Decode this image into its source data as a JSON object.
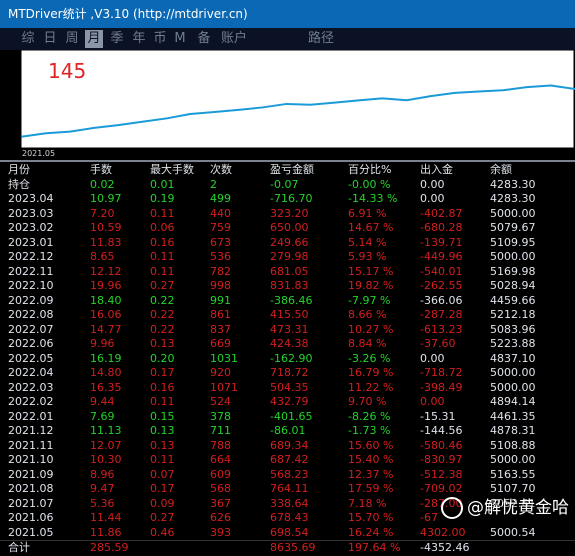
{
  "window": {
    "title": "MTDriver统计 ,V3.10 (http://mtdriver.cn)"
  },
  "tabs": [
    {
      "label": "综",
      "active": false
    },
    {
      "label": "日",
      "active": false
    },
    {
      "label": "周",
      "active": false
    },
    {
      "label": "月",
      "active": true
    },
    {
      "label": "季",
      "active": false
    },
    {
      "label": "年",
      "active": false
    },
    {
      "label": "币",
      "active": false
    },
    {
      "label": "M",
      "active": false
    },
    {
      "label": "备",
      "active": false
    },
    {
      "label": "账户",
      "active": false
    },
    {
      "label": "路径",
      "active": false
    }
  ],
  "chart": {
    "counter": "145",
    "counter_color": "#e02424",
    "line_color": "#1a9bd8",
    "x_label": "2021.05"
  },
  "chart_data": {
    "type": "line",
    "title": "",
    "xlabel": "",
    "ylabel": "",
    "x": [
      "2021.05",
      "2021.06",
      "2021.07",
      "2021.08",
      "2021.09",
      "2021.10",
      "2021.11",
      "2021.12",
      "2022.01",
      "2022.02",
      "2022.03",
      "2022.04",
      "2022.05",
      "2022.06",
      "2022.07",
      "2022.08",
      "2022.09",
      "2022.10",
      "2022.11",
      "2022.12",
      "2023.01",
      "2023.02",
      "2023.03",
      "2023.04"
    ],
    "series": [
      {
        "values": [
          698.54,
          1376.97,
          1715.61,
          2479.72,
          3047.95,
          3735.37,
          4424.71,
          5342.65,
          5741.0,
          6173.79,
          6678.14,
          7396.86,
          7234.96,
          7659.34,
          8132.65,
          8548.15,
          8161.69,
          8993.52,
          9674.57,
          9954.55,
          10204.21,
          10854.21,
          11177.41,
          10460.71
        ]
      }
    ],
    "ylim": [
      0,
      12000
    ]
  },
  "table": {
    "headers": [
      "月份",
      "手数",
      "最大手数",
      "次数",
      "盈亏金额",
      "百分比%",
      "出入金",
      "余额"
    ],
    "rows": [
      {
        "month": "持仓",
        "lots": "0.02",
        "max_lots": "0.01",
        "count": "2",
        "pnl": "-0.07",
        "pct": "-0.00 %",
        "deposit": "0.00",
        "balance": "4283.30",
        "color": "green"
      },
      {
        "month": "2023.04",
        "lots": "10.97",
        "max_lots": "0.19",
        "count": "499",
        "pnl": "-716.70",
        "pct": "-14.33 %",
        "deposit": "0.00",
        "balance": "4283.30",
        "color": "green"
      },
      {
        "month": "2023.03",
        "lots": "7.20",
        "max_lots": "0.11",
        "count": "440",
        "pnl": "323.20",
        "pct": "6.91 %",
        "deposit": "-402.87",
        "balance": "5000.00",
        "color": "red"
      },
      {
        "month": "2023.02",
        "lots": "10.59",
        "max_lots": "0.06",
        "count": "759",
        "pnl": "650.00",
        "pct": "14.67 %",
        "deposit": "-680.28",
        "balance": "5079.67",
        "color": "red"
      },
      {
        "month": "2023.01",
        "lots": "11.83",
        "max_lots": "0.16",
        "count": "673",
        "pnl": "249.66",
        "pct": "5.14 %",
        "deposit": "-139.71",
        "balance": "5109.95",
        "color": "red"
      },
      {
        "month": "2022.12",
        "lots": "8.65",
        "max_lots": "0.11",
        "count": "536",
        "pnl": "279.98",
        "pct": "5.93 %",
        "deposit": "-449.96",
        "balance": "5000.00",
        "color": "red"
      },
      {
        "month": "2022.11",
        "lots": "12.12",
        "max_lots": "0.11",
        "count": "782",
        "pnl": "681.05",
        "pct": "15.17 %",
        "deposit": "-540.01",
        "balance": "5169.98",
        "color": "red"
      },
      {
        "month": "2022.10",
        "lots": "19.96",
        "max_lots": "0.27",
        "count": "998",
        "pnl": "831.83",
        "pct": "19.82 %",
        "deposit": "-262.55",
        "balance": "5028.94",
        "color": "red"
      },
      {
        "month": "2022.09",
        "lots": "18.40",
        "max_lots": "0.22",
        "count": "991",
        "pnl": "-386.46",
        "pct": "-7.97 %",
        "deposit": "-366.06",
        "balance": "4459.66",
        "color": "green"
      },
      {
        "month": "2022.08",
        "lots": "16.06",
        "max_lots": "0.22",
        "count": "861",
        "pnl": "415.50",
        "pct": "8.66 %",
        "deposit": "-287.28",
        "balance": "5212.18",
        "color": "red"
      },
      {
        "month": "2022.07",
        "lots": "14.77",
        "max_lots": "0.22",
        "count": "837",
        "pnl": "473.31",
        "pct": "10.27 %",
        "deposit": "-613.23",
        "balance": "5083.96",
        "color": "red"
      },
      {
        "month": "2022.06",
        "lots": "9.96",
        "max_lots": "0.13",
        "count": "669",
        "pnl": "424.38",
        "pct": "8.84 %",
        "deposit": "-37.60",
        "balance": "5223.88",
        "color": "red"
      },
      {
        "month": "2022.05",
        "lots": "16.19",
        "max_lots": "0.20",
        "count": "1031",
        "pnl": "-162.90",
        "pct": "-3.26 %",
        "deposit": "0.00",
        "balance": "4837.10",
        "color": "green"
      },
      {
        "month": "2022.04",
        "lots": "14.80",
        "max_lots": "0.17",
        "count": "920",
        "pnl": "718.72",
        "pct": "16.79 %",
        "deposit": "-718.72",
        "balance": "5000.00",
        "color": "red"
      },
      {
        "month": "2022.03",
        "lots": "16.35",
        "max_lots": "0.16",
        "count": "1071",
        "pnl": "504.35",
        "pct": "11.22 %",
        "deposit": "-398.49",
        "balance": "5000.00",
        "color": "red"
      },
      {
        "month": "2022.02",
        "lots": "9.44",
        "max_lots": "0.11",
        "count": "524",
        "pnl": "432.79",
        "pct": "9.70 %",
        "deposit": "0.00",
        "balance": "4894.14",
        "color": "red"
      },
      {
        "month": "2022.01",
        "lots": "7.69",
        "max_lots": "0.15",
        "count": "378",
        "pnl": "-401.65",
        "pct": "-8.26 %",
        "deposit": "-15.31",
        "balance": "4461.35",
        "color": "green"
      },
      {
        "month": "2021.12",
        "lots": "11.13",
        "max_lots": "0.13",
        "count": "711",
        "pnl": "-86.01",
        "pct": "-1.73 %",
        "deposit": "-144.56",
        "balance": "4878.31",
        "color": "green"
      },
      {
        "month": "2021.11",
        "lots": "12.07",
        "max_lots": "0.13",
        "count": "788",
        "pnl": "689.34",
        "pct": "15.60 %",
        "deposit": "-580.46",
        "balance": "5108.88",
        "color": "red"
      },
      {
        "month": "2021.10",
        "lots": "10.30",
        "max_lots": "0.11",
        "count": "664",
        "pnl": "687.42",
        "pct": "15.40 %",
        "deposit": "-830.97",
        "balance": "5000.00",
        "color": "red"
      },
      {
        "month": "2021.09",
        "lots": "8.96",
        "max_lots": "0.07",
        "count": "609",
        "pnl": "568.23",
        "pct": "12.37 %",
        "deposit": "-512.38",
        "balance": "5163.55",
        "color": "red"
      },
      {
        "month": "2021.08",
        "lots": "9.47",
        "max_lots": "0.17",
        "count": "568",
        "pnl": "764.11",
        "pct": "17.59 %",
        "deposit": "-709.02",
        "balance": "5107.70",
        "color": "red"
      },
      {
        "month": "2021.07",
        "lots": "5.36",
        "max_lots": "0.09",
        "count": "367",
        "pnl": "338.64",
        "pct": "7.18 %",
        "deposit": "-287.00",
        "balance": "5052.61",
        "color": "red"
      },
      {
        "month": "2021.06",
        "lots": "11.44",
        "max_lots": "0.27",
        "count": "626",
        "pnl": "678.43",
        "pct": "15.70 %",
        "deposit": "-67",
        "balance": "",
        "color": "red"
      },
      {
        "month": "2021.05",
        "lots": "11.86",
        "max_lots": "0.46",
        "count": "393",
        "pnl": "698.54",
        "pct": "16.24 %",
        "deposit": "4302.00",
        "balance": "5000.54",
        "color": "red"
      }
    ],
    "total": {
      "month": "合计",
      "lots": "285.59",
      "max_lots": "",
      "count": "",
      "pnl": "8635.69",
      "pct": "197.64 %",
      "deposit": "-4352.46",
      "balance": ""
    }
  },
  "watermark": {
    "text": "@解忧黄金哈"
  }
}
